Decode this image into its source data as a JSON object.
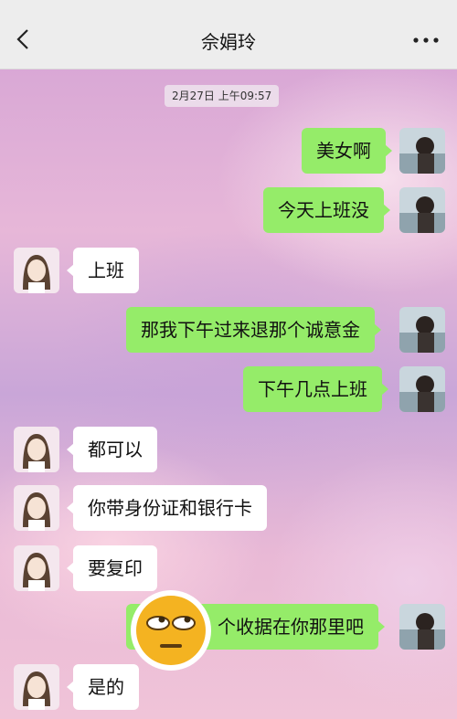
{
  "header": {
    "title": "佘娟玲"
  },
  "timestamp": "2月27日 上午09:57",
  "messages": [
    {
      "dir": "out",
      "text": "美女啊"
    },
    {
      "dir": "out",
      "text": "今天上班没"
    },
    {
      "dir": "in",
      "text": "上班"
    },
    {
      "dir": "out",
      "text": "那我下午过来退那个诚意金"
    },
    {
      "dir": "out",
      "text": "下午几点上班"
    },
    {
      "dir": "in",
      "text": "都可以"
    },
    {
      "dir": "in",
      "text": "你带身份证和银行卡"
    },
    {
      "dir": "in",
      "text": "要复印"
    },
    {
      "dir": "out",
      "text": "个收据在你那里吧"
    },
    {
      "dir": "in",
      "text": "是的"
    }
  ],
  "colors": {
    "outgoing_bubble": "#95ec69",
    "incoming_bubble": "#ffffff",
    "topbar": "#ededed"
  },
  "icons": {
    "back": "chevron-left-icon",
    "more": "more-horizontal-icon",
    "sticker": "rolling-eyes-emoji-icon"
  }
}
